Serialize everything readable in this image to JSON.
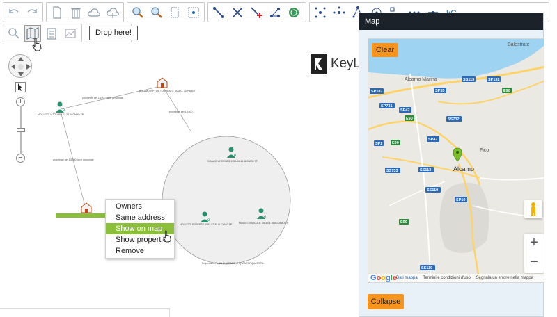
{
  "toolbar": {
    "icons_group1": [
      "undo-icon",
      "redo-icon"
    ],
    "icons_group2": [
      "new-document-icon",
      "delete-icon",
      "cloud-upload-icon",
      "cloud-download-icon"
    ],
    "icons_group3": [
      "zoom-in-icon",
      "zoom-fit-icon",
      "page-view-icon",
      "select-area-icon"
    ],
    "icons_group4": [
      "link-icon",
      "unlink-icon",
      "add-link-icon",
      "network-icon",
      "globe-icon"
    ],
    "icons_group5": [
      "layout-icon",
      "layout-organic-icon",
      "layout-hierarchy-icon",
      "layout-radial-icon",
      "layout-structured-icon",
      "layout-sequential-icon",
      "layout-tweak-icon",
      "keylines-icon"
    ],
    "row2_icons": [
      "search-icon",
      "map-icon",
      "checklist-icon",
      "chart-icon"
    ],
    "drop_label": "Drop here!"
  },
  "logo": {
    "text": "KeyLines"
  },
  "graph": {
    "edges": [
      {
        "label": "proprietari per 1/1000 bene personale"
      },
      {
        "label": "proprietari per 1/1000"
      },
      {
        "label": "proprietari per 1/1000 bene personale"
      }
    ],
    "nodes": [
      {
        "label": "ALCAMO (TP) VIA TORQUATO TASSO, 30 Piano T"
      },
      {
        "label": "MOLLETTI VITO 1953-07-23 ALCAMO TP"
      },
      {
        "label": "GRALIO VINCENZO 1953-06-15 ALCAMO TP"
      },
      {
        "label": "MOLLETTI ROBERTO 1983-07-30 ALCAMO TP"
      },
      {
        "label": "MOLLETTI MICOLE 1983-04-16 ALCAMO TP"
      },
      {
        "label": "ALCAMO (TP) VIA TORQUATO TASSO, 30"
      },
      {
        "label": "Proprietario/Partita di ALCAMO (TP) VIA TORQUATO TA..."
      }
    ]
  },
  "context_menu": {
    "items": [
      "Owners",
      "Same address",
      "Show on map",
      "Show properties",
      "Remove"
    ],
    "active_index": 2
  },
  "map_window": {
    "title": "Map",
    "clear_label": "Clear",
    "collapse_label": "Collapse",
    "places": [
      "Balestrate",
      "Alcamo Marina",
      "Fico",
      "Alcamo"
    ],
    "roads": [
      "SP187",
      "SP55",
      "SS113",
      "SP132",
      "E90",
      "SP731",
      "SP47",
      "E90",
      "SS732",
      "SP2",
      "E90",
      "SP47",
      "SS733",
      "SS113",
      "SS119",
      "SP10",
      "E90",
      "SS119"
    ],
    "zoom_in": "+",
    "zoom_out": "−",
    "google": "Google",
    "footer_links": [
      "Dati mappa",
      "Termini e condizioni d'uso",
      "Segnala un errore nella mappa"
    ]
  }
}
